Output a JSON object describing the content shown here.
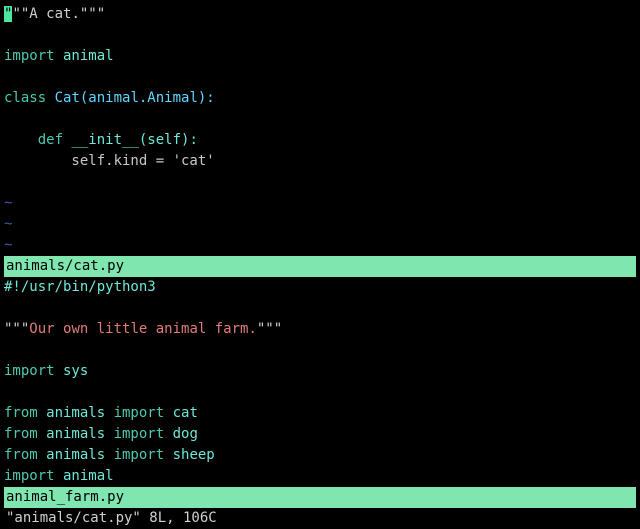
{
  "top_buffer": {
    "cursor_char": "\"",
    "docstring_rest": "\"\"A cat.\"\"\"",
    "import_kw": "import",
    "import_mod": " animal",
    "class_kw": "class",
    "class_decl": " Cat(animal.Animal):",
    "def_kw": "def",
    "def_sig": " __init__(self):",
    "body": "        self.kind = 'cat'",
    "indent_def": "    ",
    "tilde": "~"
  },
  "status_top": "animals/cat.py",
  "bottom_buffer": {
    "shebang": "#!/usr/bin/python3",
    "doc_q_open": "\"\"\"",
    "doc_text": "Our own little animal farm.",
    "doc_q_close": "\"\"\"",
    "imp_kw": "import",
    "imp_sys": " sys",
    "from_kw": "from",
    "animals": " animals ",
    "import_kw2": "import",
    "cat": " cat",
    "dog": " dog",
    "sheep": " sheep",
    "imp_animal": " animal"
  },
  "status_bottom": "animal_farm.py",
  "command_line": "\"animals/cat.py\" 8L, 106C"
}
